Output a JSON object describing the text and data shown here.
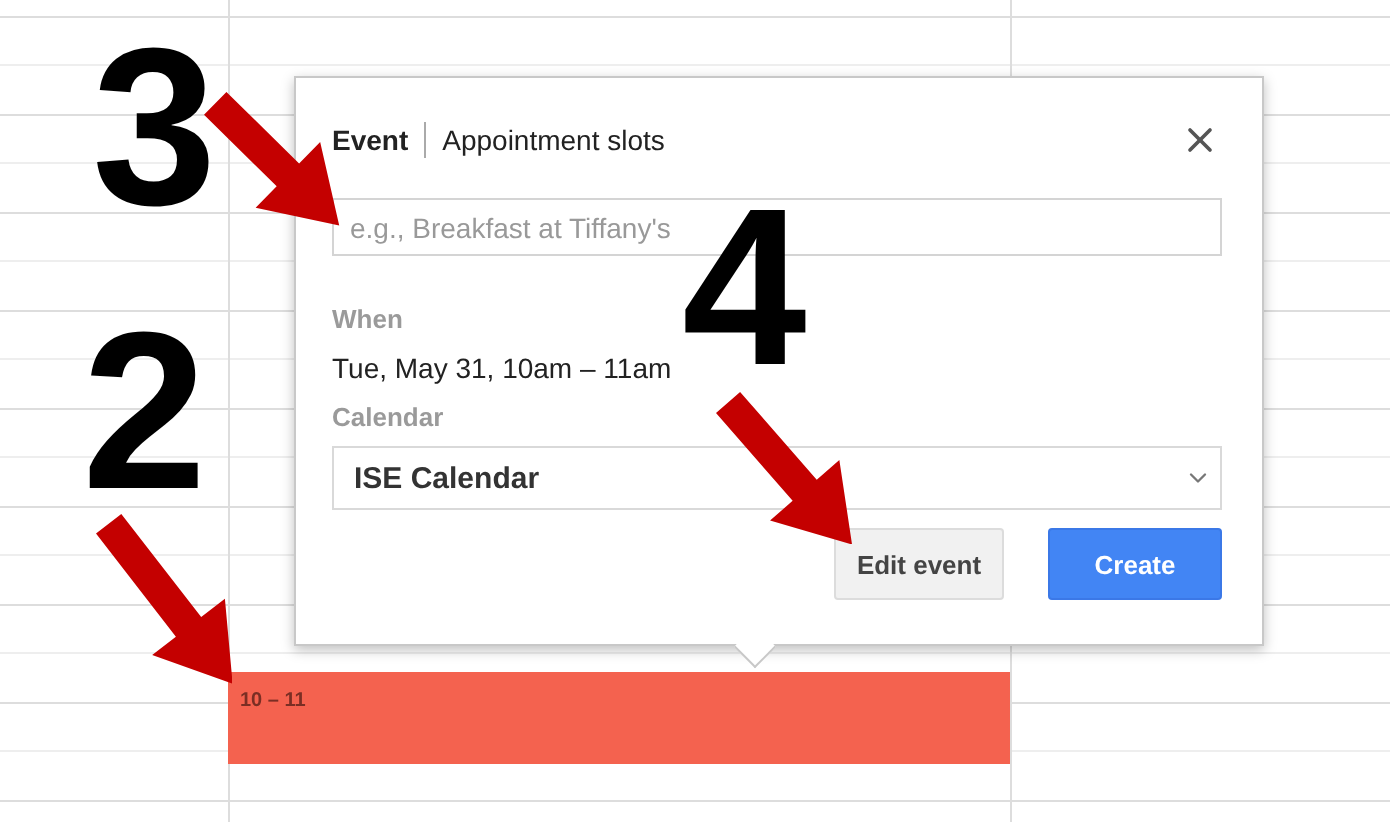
{
  "event_block": {
    "time": "10 – 11"
  },
  "popup": {
    "tabs": [
      {
        "label": "Event",
        "selected": true
      },
      {
        "label": "Appointment slots",
        "selected": false
      }
    ],
    "title_field": {
      "placeholder": "e.g., Breakfast at Tiffany's"
    },
    "when_label": "When",
    "when_value": "Tue, May 31, 10am – 11am",
    "calendar_label": "Calendar",
    "calendar_select": {
      "value": "ISE Calendar"
    },
    "buttons": [
      {
        "label": "Edit event",
        "kind": "secondary"
      },
      {
        "label": "Create",
        "kind": "primary"
      }
    ]
  },
  "annotations": [
    {
      "label": "3"
    },
    {
      "label": "2"
    },
    {
      "label": "4"
    }
  ]
}
